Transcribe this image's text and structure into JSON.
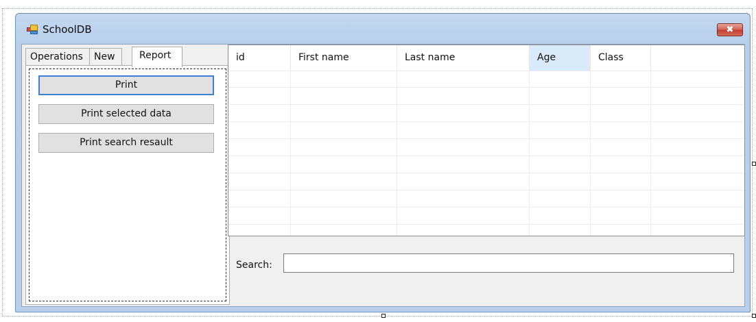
{
  "window": {
    "title": "SchoolDB",
    "close_glyph": "✖",
    "app_icon": "form-icon"
  },
  "tabs": [
    {
      "label": "Operations",
      "selected": false
    },
    {
      "label": "New",
      "selected": false
    },
    {
      "label": "Report",
      "selected": true
    }
  ],
  "report": {
    "buttons": [
      {
        "label": "Print",
        "focused": true
      },
      {
        "label": "Print selected data",
        "focused": false
      },
      {
        "label": "Print search resault",
        "focused": false
      }
    ]
  },
  "grid": {
    "columns": [
      "id",
      "First name",
      "Last name",
      "Age",
      "Class"
    ],
    "highlighted_column": "Age",
    "rows": []
  },
  "search": {
    "label": "Search:",
    "value": "",
    "placeholder": ""
  },
  "colors": {
    "selected_header": "#d9eaf9",
    "focus_border": "#3c7fd6",
    "close_button": "#c2402f"
  }
}
